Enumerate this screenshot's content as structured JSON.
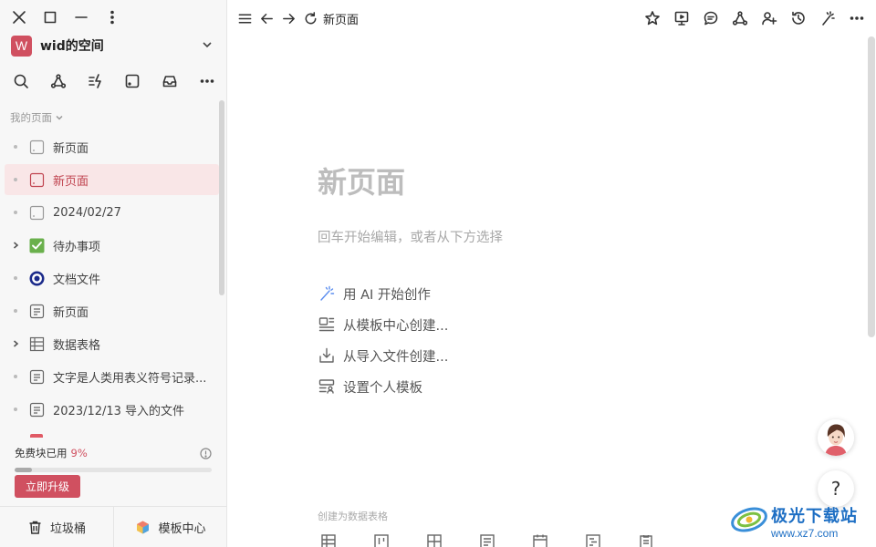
{
  "workspace": {
    "avatar_letter": "W",
    "name": "wid的空间"
  },
  "sidebar": {
    "section_label": "我的页面",
    "items": [
      {
        "label": "新页面",
        "icon": "page-icon",
        "lead": "dot",
        "active": false
      },
      {
        "label": "新页面",
        "icon": "page-icon",
        "lead": "dot",
        "active": true
      },
      {
        "label": "2024/02/27",
        "icon": "page-icon",
        "lead": "dot",
        "active": false
      },
      {
        "label": "待办事项",
        "icon": "green-check-icon",
        "lead": "caret",
        "active": false
      },
      {
        "label": "文档文件",
        "icon": "circle-target-icon",
        "lead": "dot",
        "active": false
      },
      {
        "label": "新页面",
        "icon": "doc-icon",
        "lead": "dot",
        "active": false
      },
      {
        "label": "数据表格",
        "icon": "table-icon",
        "lead": "caret",
        "active": false
      },
      {
        "label": "文字是人类用表义符号记录...",
        "icon": "doc-icon",
        "lead": "dot",
        "active": false
      },
      {
        "label": "2023/12/13 导入的文件",
        "icon": "doc-icon",
        "lead": "dot",
        "active": false
      }
    ],
    "quota": {
      "label": "免费块已用",
      "percent_text": "9%",
      "percent_value": 9
    },
    "upgrade_label": "立即升级",
    "trash_label": "垃圾桶",
    "templates_label": "模板中心"
  },
  "topbar": {
    "breadcrumb": "新页面"
  },
  "document": {
    "title": "新页面",
    "hint": "回车开始编辑，或者从下方选择",
    "options": [
      {
        "label": "用 AI 开始创作",
        "icon": "ai-wand-icon"
      },
      {
        "label": "从模板中心创建...",
        "icon": "template-icon"
      },
      {
        "label": "从导入文件创建...",
        "icon": "import-icon"
      },
      {
        "label": "设置个人模板",
        "icon": "personal-template-icon"
      }
    ],
    "database_label": "创建为数据表格"
  },
  "help_label": "?",
  "watermark": {
    "title": "极光下载站",
    "url": "www.xz7.com"
  },
  "colors": {
    "accent": "#d05060",
    "active_bg": "#f9e6e7",
    "sidebar_bg": "#f7f7f7"
  }
}
